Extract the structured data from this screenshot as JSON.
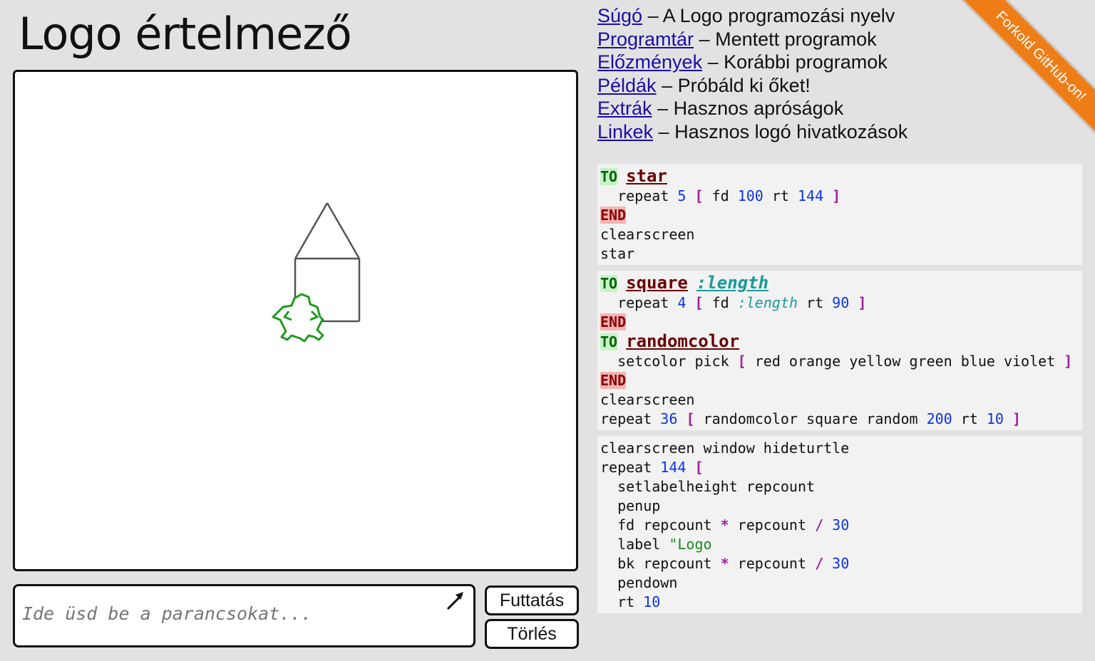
{
  "app": {
    "title": "Logo értelmező"
  },
  "nav": [
    {
      "link": "Súgó",
      "desc": "A Logo programozási nyelv"
    },
    {
      "link": "Programtár",
      "desc": "Mentett programok"
    },
    {
      "link": "Előzmények",
      "desc": "Korábbi programok"
    },
    {
      "link": "Példák",
      "desc": "Próbáld ki őket!"
    },
    {
      "link": "Extrák",
      "desc": "Hasznos apróságok"
    },
    {
      "link": "Linkek",
      "desc": "Hasznos logó hivatkozások"
    }
  ],
  "nav_separator": " – ",
  "ribbon": {
    "label": "Forkold GitHub-on!"
  },
  "command": {
    "placeholder": "Ide üsd be a parancsokat..."
  },
  "buttons": {
    "run": "Futtatás",
    "clear": "Törlés"
  },
  "icons": {
    "expand": "expand-arrow-icon",
    "turtle": "turtle-icon"
  },
  "colors": {
    "accent_ribbon": "#ef7d17",
    "link": "#1a0dab",
    "keyword_to_bg": "#c6f2c6",
    "keyword_end_bg": "#f4b4b4",
    "number": "#0b33e6",
    "bracket": "#a020a0",
    "turtle": "#1e9a1e"
  },
  "examples": [
    [
      [
        [
          "kw-to",
          "TO"
        ],
        [
          "t",
          " "
        ],
        [
          "proc",
          "star"
        ]
      ],
      [
        [
          "t",
          "  repeat "
        ],
        [
          "num",
          "5"
        ],
        [
          "t",
          " "
        ],
        [
          "br",
          "["
        ],
        [
          "t",
          " fd "
        ],
        [
          "num",
          "100"
        ],
        [
          "t",
          " rt "
        ],
        [
          "num",
          "144"
        ],
        [
          "t",
          " "
        ],
        [
          "br",
          "]"
        ]
      ],
      [
        [
          "kw-end",
          "END"
        ]
      ],
      [
        [
          "t",
          "clearscreen"
        ]
      ],
      [
        [
          "t",
          "star"
        ]
      ]
    ],
    [
      [
        [
          "kw-to",
          "TO"
        ],
        [
          "t",
          " "
        ],
        [
          "proc",
          "square"
        ],
        [
          "t",
          " "
        ],
        [
          "param",
          ":length"
        ]
      ],
      [
        [
          "t",
          "  repeat "
        ],
        [
          "num",
          "4"
        ],
        [
          "t",
          " "
        ],
        [
          "br",
          "["
        ],
        [
          "t",
          " fd "
        ],
        [
          "var",
          ":length"
        ],
        [
          "t",
          " rt "
        ],
        [
          "num",
          "90"
        ],
        [
          "t",
          " "
        ],
        [
          "br",
          "]"
        ]
      ],
      [
        [
          "kw-end",
          "END"
        ]
      ],
      [
        [
          "kw-to",
          "TO"
        ],
        [
          "t",
          " "
        ],
        [
          "proc",
          "randomcolor"
        ]
      ],
      [
        [
          "t",
          "  setcolor pick "
        ],
        [
          "br",
          "["
        ],
        [
          "t",
          " red orange yellow green blue violet "
        ],
        [
          "br",
          "]"
        ]
      ],
      [
        [
          "kw-end",
          "END"
        ]
      ],
      [
        [
          "t",
          "clearscreen"
        ]
      ],
      [
        [
          "t",
          "repeat "
        ],
        [
          "num",
          "36"
        ],
        [
          "t",
          " "
        ],
        [
          "br",
          "["
        ],
        [
          "t",
          " randomcolor square random "
        ],
        [
          "num",
          "200"
        ],
        [
          "t",
          " rt "
        ],
        [
          "num",
          "10"
        ],
        [
          "t",
          " "
        ],
        [
          "br",
          "]"
        ]
      ]
    ],
    [
      [
        [
          "t",
          "clearscreen window hideturtle"
        ]
      ],
      [
        [
          "t",
          "repeat "
        ],
        [
          "num",
          "144"
        ],
        [
          "t",
          " "
        ],
        [
          "br",
          "["
        ]
      ],
      [
        [
          "t",
          "  setlabelheight repcount"
        ]
      ],
      [
        [
          "t",
          "  penup"
        ]
      ],
      [
        [
          "t",
          "  fd repcount "
        ],
        [
          "op",
          "*"
        ],
        [
          "t",
          " repcount "
        ],
        [
          "op",
          "/"
        ],
        [
          "t",
          " "
        ],
        [
          "num",
          "30"
        ]
      ],
      [
        [
          "t",
          "  label "
        ],
        [
          "str",
          "\"Logo"
        ]
      ],
      [
        [
          "t",
          "  bk repcount "
        ],
        [
          "op",
          "*"
        ],
        [
          "t",
          " repcount "
        ],
        [
          "op",
          "/"
        ],
        [
          "t",
          " "
        ],
        [
          "num",
          "30"
        ]
      ],
      [
        [
          "t",
          "  pendown"
        ]
      ],
      [
        [
          "t",
          "  rt "
        ],
        [
          "num",
          "10"
        ]
      ]
    ]
  ]
}
